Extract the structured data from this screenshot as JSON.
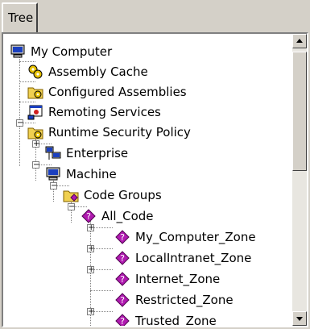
{
  "tabs": [
    {
      "label": "Tree"
    }
  ],
  "tree": {
    "nodes": [
      {
        "label": "My Computer",
        "icon": "computer-icon"
      },
      {
        "label": "Assembly Cache",
        "icon": "gears-icon"
      },
      {
        "label": "Configured Assemblies",
        "icon": "folder-gear-icon"
      },
      {
        "label": "Remoting Services",
        "icon": "window-app-icon"
      },
      {
        "label": "Runtime Security Policy",
        "icon": "folder-gear-icon"
      },
      {
        "label": "Enterprise",
        "icon": "network-computers-icon"
      },
      {
        "label": "Machine",
        "icon": "computer-icon"
      },
      {
        "label": "Code Groups",
        "icon": "folder-diamond-icon"
      },
      {
        "label": "All_Code",
        "icon": "purple-diamond-icon"
      },
      {
        "label": "My_Computer_Zone",
        "icon": "purple-diamond-icon"
      },
      {
        "label": "LocalIntranet_Zone",
        "icon": "purple-diamond-icon"
      },
      {
        "label": "Internet_Zone",
        "icon": "purple-diamond-icon"
      },
      {
        "label": "Restricted_Zone",
        "icon": "purple-diamond-icon"
      },
      {
        "label": "Trusted_Zone",
        "icon": "purple-diamond-icon"
      }
    ]
  },
  "colors": {
    "diamond": "#b01ab0",
    "folder": "#f0d050",
    "gear": "#d8b000"
  }
}
